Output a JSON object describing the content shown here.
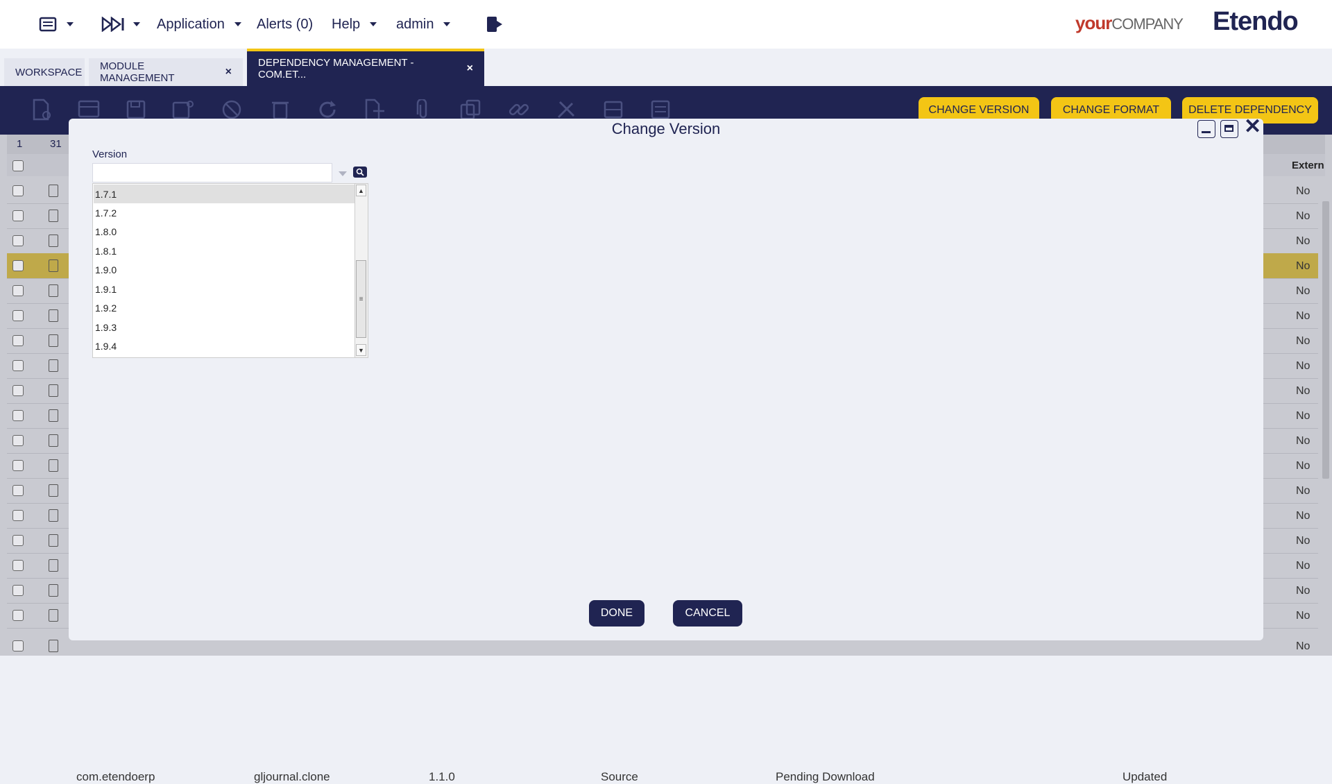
{
  "topbar": {
    "application_label": "Application",
    "alerts_label": "Alerts (0)",
    "help_label": "Help",
    "user_label": "admin",
    "logo_your": "your",
    "logo_company": "COMPANY",
    "logo_etendo": "Etendo"
  },
  "tabs": [
    {
      "label": "WORKSPACE"
    },
    {
      "label": "MODULE MANAGEMENT",
      "close": "×"
    },
    {
      "label": "DEPENDENCY MANAGEMENT - COM.ET...",
      "close": "×"
    }
  ],
  "toolbar": {
    "change_version_label": "CHANGE VERSION",
    "change_format_label": "CHANGE FORMAT",
    "delete_dependency_label": "DELETE DEPENDENCY"
  },
  "grid": {
    "page_num": "1",
    "total_count": "31",
    "extern_header": "Extern",
    "no_value": "No",
    "last_row": {
      "module": "com.etendoerp",
      "name": "gljournal.clone",
      "version": "1.1.0",
      "format": "Source",
      "status": "Pending Download",
      "action": "Updated",
      "extern": "No"
    }
  },
  "dialog": {
    "title": "Change Version",
    "version_label": "Version",
    "version_value": "",
    "options": [
      "1.7.1",
      "1.7.2",
      "1.8.0",
      "1.8.1",
      "1.9.0",
      "1.9.1",
      "1.9.2",
      "1.9.3",
      "1.9.4"
    ],
    "done_label": "DONE",
    "cancel_label": "CANCEL"
  }
}
